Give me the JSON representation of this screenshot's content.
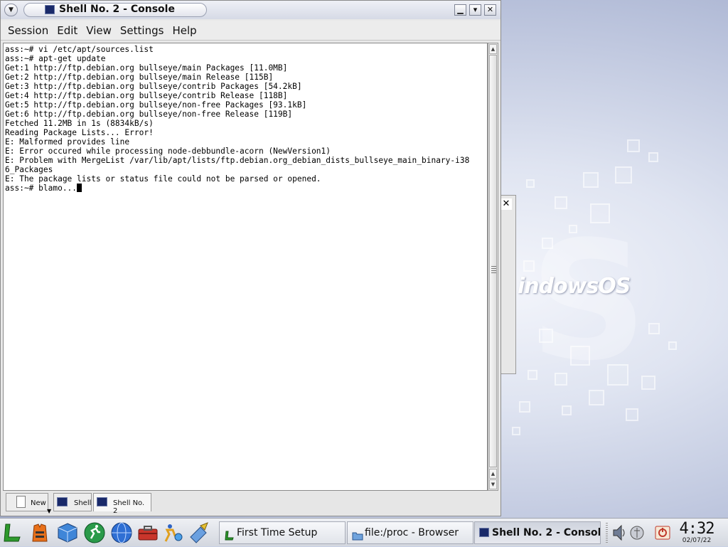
{
  "window": {
    "title": "Shell No. 2 - Console",
    "menu_icon": "chevron-down-icon",
    "buttons": [
      "minimize-icon",
      "maximize-icon",
      "close-icon"
    ],
    "buttons_text": {
      "minimize": "▁",
      "maximize": "▾",
      "close": "✕"
    }
  },
  "menu": {
    "session": "Session",
    "edit": "Edit",
    "view": "View",
    "settings": "Settings",
    "help": "Help"
  },
  "terminal": {
    "lines": [
      "ass:~# vi /etc/apt/sources.list",
      "ass:~# apt-get update",
      "Get:1 http://ftp.debian.org bullseye/main Packages [11.0MB]",
      "Get:2 http://ftp.debian.org bullseye/main Release [115B]",
      "Get:3 http://ftp.debian.org bullseye/contrib Packages [54.2kB]",
      "Get:4 http://ftp.debian.org bullseye/contrib Release [118B]",
      "Get:5 http://ftp.debian.org bullseye/non-free Packages [93.1kB]",
      "Get:6 http://ftp.debian.org bullseye/non-free Release [119B]",
      "Fetched 11.2MB in 1s (8834kB/s)",
      "Reading Package Lists... Error!",
      "E: Malformed provides line",
      "E: Error occured while processing node-debbundle-acorn (NewVersion1)",
      "E: Problem with MergeList /var/lib/apt/lists/ftp.debian.org_debian_dists_bullseye_main_binary-i38",
      "6_Packages",
      "E: The package lists or status file could not be parsed or opened."
    ],
    "prompt_line": "ass:~# blamo..."
  },
  "tabs": [
    {
      "label": "New",
      "icon": "new-document-icon"
    },
    {
      "label": "Shell",
      "icon": "console-icon"
    },
    {
      "label": "Shell No. 2",
      "icon": "console-icon",
      "active": true
    }
  ],
  "desktop": {
    "logo_text": "indowsOS",
    "background_window_close": "✕"
  },
  "taskbar": {
    "launchers": [
      "lindows-start-icon",
      "lifejacket-icon",
      "cube-icon",
      "runner-icon",
      "globe-icon",
      "toolbox-icon",
      "figure-icon",
      "pen-tablet-icon"
    ],
    "tasks": [
      {
        "label": "First Time Setup",
        "icon": "setup-icon"
      },
      {
        "label": "file:/proc - Browser",
        "icon": "folder-icon"
      },
      {
        "label": "Shell No. 2 - Console",
        "icon": "console-icon",
        "active": true
      }
    ],
    "tray": [
      "volume-icon",
      "network-icon",
      "power-icon"
    ],
    "clock_time": "4:32",
    "clock_date": "02/07/22"
  },
  "colors": {
    "terminal_bg": "#ffffff",
    "terminal_fg": "#000000",
    "desktop_accent": "#9aa5c6"
  }
}
